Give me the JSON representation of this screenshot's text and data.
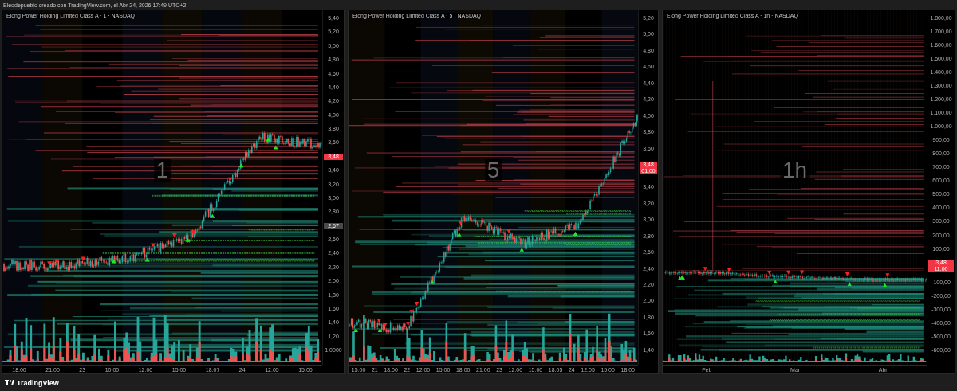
{
  "header": {
    "caption": "Eleodepueblo creado con TradingView.com, el Abr 24, 2026 17:49 UTC+2"
  },
  "panels": [
    {
      "legend": "Elong Power Holding Limited Class A · 1 · NASDAQ",
      "interval": "1",
      "y_ticks": [
        "5,40",
        "5,20",
        "5,00",
        "4,80",
        "4,60",
        "4,40",
        "4,20",
        "4,00",
        "3,80",
        "3,60",
        "3,40",
        "3,20",
        "3,00",
        "2,80",
        "2,60",
        "2,40",
        "2,20",
        "2,00",
        "1,80",
        "1,60",
        "1,40",
        "1,20",
        "1,0000"
      ],
      "x_ticks": [
        "18:00",
        "21:00",
        "23",
        "10:00",
        "12:00",
        "15:00",
        "18:07",
        "24",
        "12:05",
        "15:00"
      ],
      "price_badge": {
        "price": "3,48"
      },
      "level_badge": "2,67"
    },
    {
      "legend": "Elong Power Holding Limited Class A · 5 · NASDAQ",
      "interval": "5",
      "y_ticks": [
        "5,20",
        "5,00",
        "4,80",
        "4,60",
        "4,40",
        "4,20",
        "4,00",
        "3,80",
        "3,60",
        "3,40",
        "3,20",
        "3,00",
        "2,80",
        "2,60",
        "2,40",
        "2,20",
        "2,00",
        "1,80",
        "1,60",
        "1,40"
      ],
      "x_ticks": [
        "15:00",
        "21",
        "18:00",
        "22",
        "12:00",
        "15:00",
        "18:00",
        "21:00",
        "23",
        "12:00",
        "15:00",
        "18:05",
        "24",
        "12:05",
        "15:00",
        "18:00"
      ],
      "price_badge": {
        "price": "3,48",
        "time": "01:00"
      }
    },
    {
      "legend": "Elong Power Holding Limited Class A · 1h · NASDAQ",
      "interval": "1h",
      "y_ticks": [
        "1.800,00",
        "1.700,00",
        "1.600,00",
        "1.500,00",
        "1.400,00",
        "1.300,00",
        "1.200,00",
        "1.100,00",
        "1.000,00",
        "900,00",
        "800,00",
        "700,00",
        "600,00",
        "500,00",
        "400,00",
        "300,00",
        "200,00",
        "100,00",
        "-100,00",
        "-200,00",
        "-300,00",
        "-400,00",
        "-500,00",
        "-600,00"
      ],
      "x_ticks": [
        "Feb",
        "Mar",
        "Abr"
      ],
      "price_badge": {
        "price": "3,48",
        "time": "11:00"
      }
    }
  ],
  "footer": {
    "brand": "TradingView"
  }
}
